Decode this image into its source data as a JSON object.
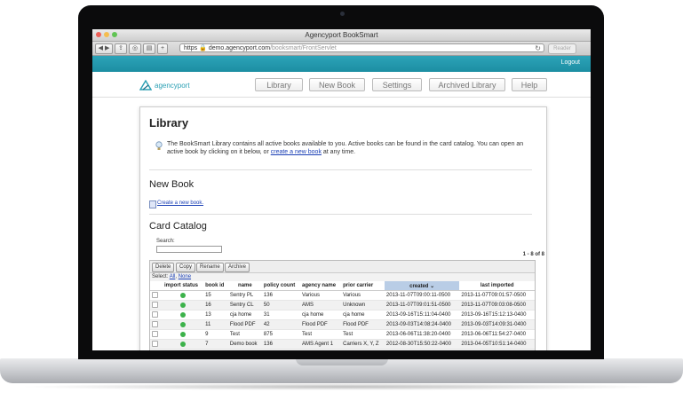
{
  "browser": {
    "window_title": "Agencyport BookSmart",
    "url_scheme": "https",
    "url_domain": "demo.agencyport.com",
    "url_path": "/booksmart/FrontServlet",
    "reader_label": "Reader"
  },
  "header": {
    "logout_label": "Logout"
  },
  "brand": {
    "logo_text": "agencyport"
  },
  "nav": {
    "tabs": [
      "Library",
      "New Book",
      "Settings",
      "Archived Library",
      "Help"
    ]
  },
  "library": {
    "title": "Library",
    "info_text_part1": "The BookSmart Library contains all active books available to you. Active books can be found in the card catalog. You can open an active book by clicking on it below, or ",
    "info_link": "create a new book",
    "info_text_part2": " at any time."
  },
  "new_book": {
    "title": "New Book",
    "link": "Create a new book."
  },
  "catalog": {
    "title": "Card Catalog",
    "search_label": "Search:",
    "search_value": "",
    "record_count": "1 - 8 of 8",
    "actions": [
      "Delete",
      "Copy",
      "Rename",
      "Archive"
    ],
    "select_prefix": "Select:",
    "select_all": "All",
    "select_none": "None",
    "columns": [
      "import status",
      "book id",
      "name",
      "policy count",
      "agency name",
      "prior carrier",
      "created",
      "last imported"
    ],
    "rows": [
      {
        "book_id": "15",
        "name": "Sentry PL",
        "policy_count": "136",
        "agency": "Various",
        "prior_carrier": "Various",
        "created": "2013-11-07T09:00:11-0500",
        "last_imported": "2013-11-07T09:01:57-0500"
      },
      {
        "book_id": "16",
        "name": "Sentry CL",
        "policy_count": "50",
        "agency": "AMS",
        "prior_carrier": "Unknown",
        "created": "2013-11-07T09:01:51-0500",
        "last_imported": "2013-11-07T09:03:08-0500"
      },
      {
        "book_id": "13",
        "name": "cja home",
        "policy_count": "31",
        "agency": "cja home",
        "prior_carrier": "cja home",
        "created": "2013-09-16T15:11:04-0400",
        "last_imported": "2013-09-16T15:12:13-0400"
      },
      {
        "book_id": "11",
        "name": "Flood PDF",
        "policy_count": "42",
        "agency": "Flood PDF",
        "prior_carrier": "Flood PDF",
        "created": "2013-09-03T14:08:24-0400",
        "last_imported": "2013-09-03T14:09:31-0400"
      },
      {
        "book_id": "9",
        "name": "Test",
        "policy_count": "875",
        "agency": "Test",
        "prior_carrier": "Test",
        "created": "2013-06-06T11:38:20-0400",
        "last_imported": "2013-06-06T11:54:27-0400"
      },
      {
        "book_id": "7",
        "name": "Demo book",
        "policy_count": "136",
        "agency": "AMS Agent 1",
        "prior_carrier": "Carriers X, Y, Z",
        "created": "2012-08-30T15:50:22-0400",
        "last_imported": "2013-04-05T10:51:14-0400"
      }
    ]
  },
  "colors": {
    "header_teal": "#2ca3b8",
    "link_blue": "#1a3fb5",
    "status_ok": "#3cb24a",
    "sorted_column": "#b9cde6"
  }
}
